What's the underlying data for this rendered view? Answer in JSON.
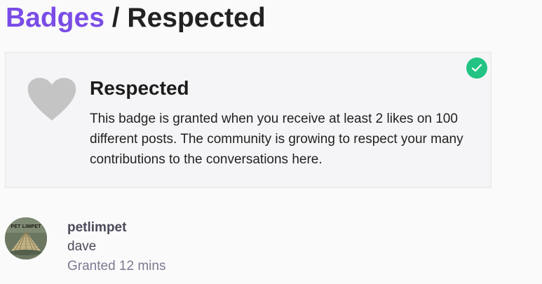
{
  "header": {
    "breadcrumb_link": "Badges",
    "separator": "/",
    "page_title": "Respected"
  },
  "badge": {
    "name": "Respected",
    "description": "This badge is granted when you receive at least 2 likes on 100 different posts. The community is growing to respect your many contributions to the conversations here.",
    "icon": "heart-icon",
    "granted_indicator_icon": "check-circle-icon",
    "colors": {
      "link": "#7a4ce6",
      "check": "#22c383",
      "icon": "#c4c4c4"
    }
  },
  "grant": {
    "avatar_label": "PET LIMPET",
    "username": "petlimpet",
    "full_name": "dave",
    "granted_text": "Granted 12 mins"
  }
}
